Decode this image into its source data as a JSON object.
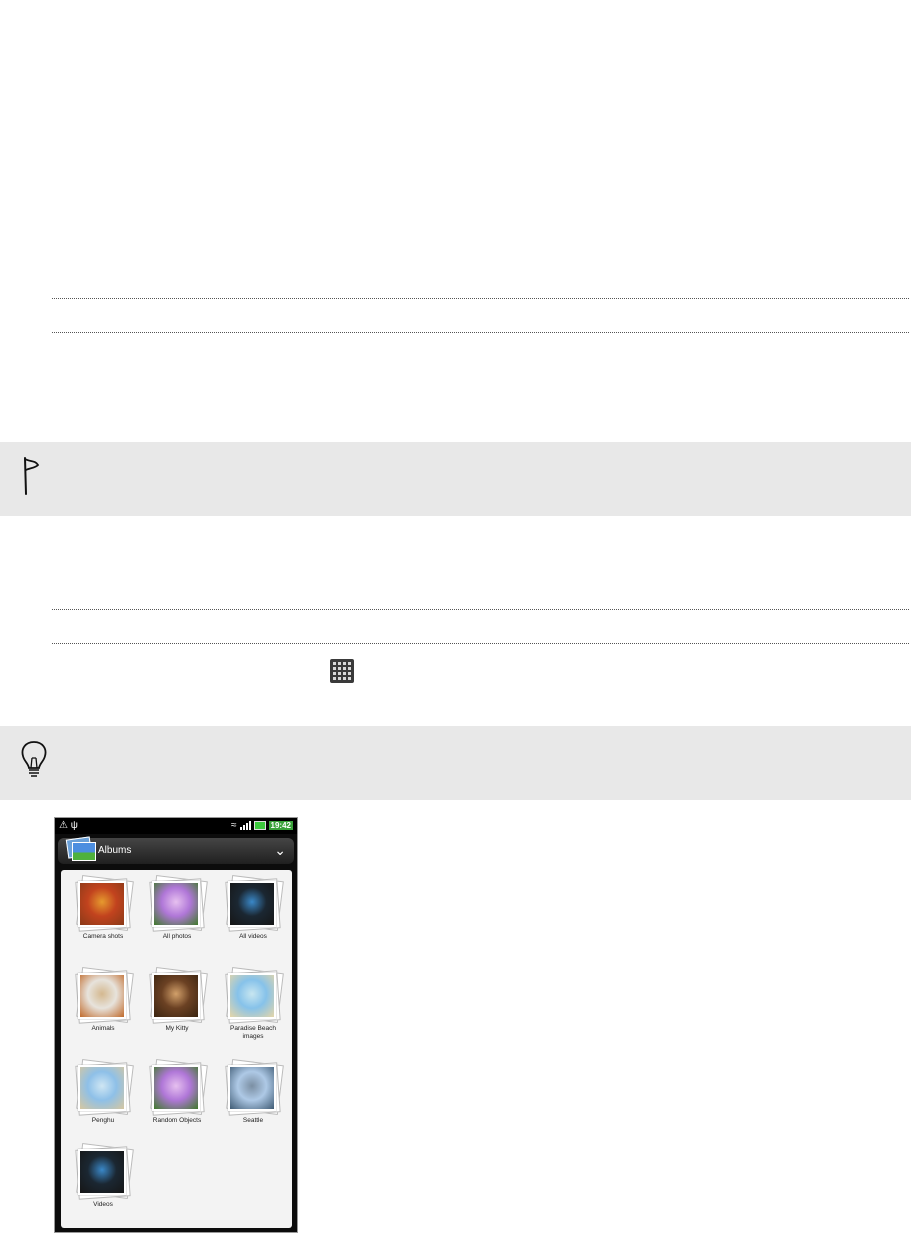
{
  "phone": {
    "status_bar": {
      "left_icons": "⚠ ψ",
      "time": "19:42"
    },
    "header": {
      "title": "Albums"
    },
    "albums": [
      {
        "label": "Camera shots",
        "colors": [
          "#c2431e",
          "#e69a2e",
          "#8a3a18"
        ]
      },
      {
        "label": "All photos",
        "colors": [
          "#b077d8",
          "#e6c0ef",
          "#3f7a2a"
        ]
      },
      {
        "label": "All videos",
        "colors": [
          "#1b2732",
          "#3a88c8",
          "#161616"
        ]
      },
      {
        "label": "Animals",
        "colors": [
          "#e7e3dc",
          "#d4b88f",
          "#c06a2b"
        ]
      },
      {
        "label": "My Kitty",
        "colors": [
          "#6b4123",
          "#d2a06a",
          "#3a2410"
        ]
      },
      {
        "label": "Paradise Beach images",
        "colors": [
          "#86c2ea",
          "#c8e6f0",
          "#e6d6a8"
        ]
      },
      {
        "label": "Penghu",
        "colors": [
          "#8ec0e8",
          "#cfe6f3",
          "#d7c7a0"
        ]
      },
      {
        "label": "Random Objects",
        "colors": [
          "#b077d8",
          "#e6c0ef",
          "#3f7a2a"
        ]
      },
      {
        "label": "Seattle",
        "colors": [
          "#aec9e6",
          "#7b8fa3",
          "#3f5b74"
        ]
      },
      {
        "label": "Videos",
        "colors": [
          "#1b2732",
          "#3a88c8",
          "#161616"
        ]
      }
    ]
  }
}
